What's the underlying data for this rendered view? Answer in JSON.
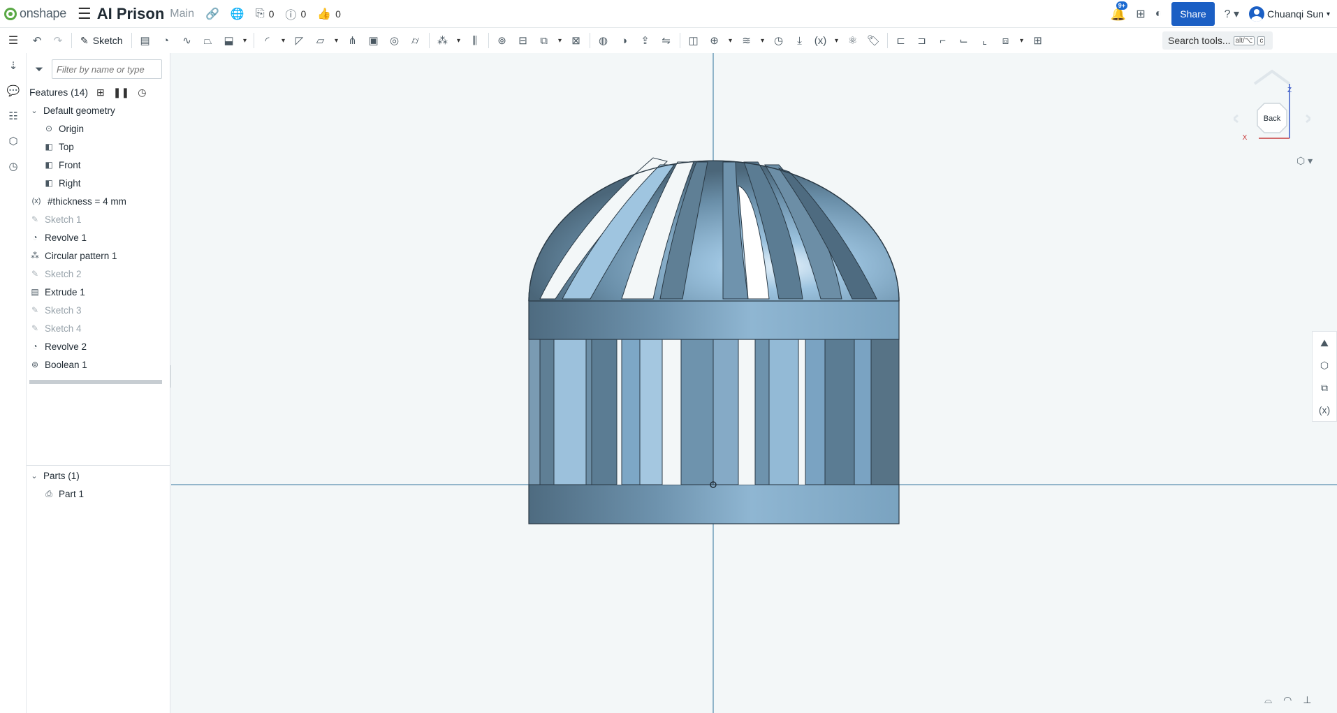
{
  "app": {
    "logo_text": "onshape",
    "title": "AI Prison",
    "branch": "Main"
  },
  "topbar": {
    "versions_count": "0",
    "comments_count": "0",
    "likes_count": "0",
    "notification_badge": "9+",
    "share_label": "Share",
    "user_name": "Chuanqi Sun"
  },
  "toolbar": {
    "sketch_label": "Sketch",
    "search_label": "Search tools...",
    "search_shortcut_mod": "alt/⌥",
    "search_shortcut_key": "c"
  },
  "feature_panel": {
    "filter_placeholder": "Filter by name or type",
    "features_title": "Features (14)",
    "items": [
      {
        "label": "Default geometry",
        "kind": "group",
        "icon": "chevron-down-icon"
      },
      {
        "label": "Origin",
        "kind": "child",
        "icon": "origin-icon"
      },
      {
        "label": "Top",
        "kind": "child",
        "icon": "plane-icon"
      },
      {
        "label": "Front",
        "kind": "child",
        "icon": "plane-icon"
      },
      {
        "label": "Right",
        "kind": "child",
        "icon": "plane-icon"
      },
      {
        "label": "#thickness = 4 mm",
        "kind": "variable",
        "icon": "variable-icon"
      },
      {
        "label": "Sketch 1",
        "kind": "sketch",
        "icon": "sketch-icon"
      },
      {
        "label": "Revolve 1",
        "kind": "feature",
        "icon": "revolve-icon"
      },
      {
        "label": "Circular pattern 1",
        "kind": "feature",
        "icon": "circular-pattern-icon"
      },
      {
        "label": "Sketch 2",
        "kind": "sketch",
        "icon": "sketch-icon"
      },
      {
        "label": "Extrude 1",
        "kind": "feature",
        "icon": "extrude-icon"
      },
      {
        "label": "Sketch 3",
        "kind": "sketch",
        "icon": "sketch-icon"
      },
      {
        "label": "Sketch 4",
        "kind": "sketch",
        "icon": "sketch-icon"
      },
      {
        "label": "Revolve 2",
        "kind": "feature",
        "icon": "revolve-icon"
      },
      {
        "label": "Boolean 1",
        "kind": "feature",
        "icon": "boolean-icon"
      }
    ],
    "parts_title": "Parts (1)",
    "parts": [
      {
        "label": "Part 1",
        "icon": "part-icon"
      }
    ]
  },
  "view_cube": {
    "face_label": "Back",
    "axis_z": "Z",
    "axis_x": "X"
  },
  "colors": {
    "accent": "#1b5fc4",
    "model": "#7fa9c8",
    "model_dark": "#4f6f86",
    "axis": "#5a8fb0"
  }
}
